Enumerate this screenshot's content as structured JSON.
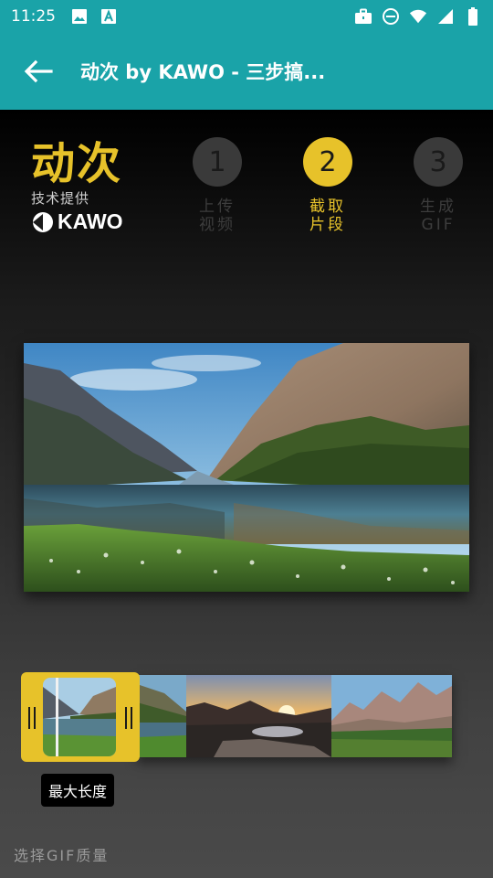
{
  "status_bar": {
    "time": "11:25",
    "icons_left": [
      "image-icon",
      "font-app-icon"
    ],
    "icons_right": [
      "briefcase-icon",
      "do-not-disturb-icon",
      "wifi-icon",
      "signal-icon",
      "battery-icon"
    ],
    "background": "#1aa3a8"
  },
  "app_bar": {
    "title": "动次 by KAWO - 三步搞...",
    "back_icon": "arrow-left-icon",
    "background": "#1aa3a8"
  },
  "brand": {
    "title": "动次",
    "subtitle": "技术提供",
    "logo_text": "KAWO",
    "accent_color": "#e7c22a"
  },
  "steps": [
    {
      "number": "1",
      "line1": "上传",
      "line2": "视频",
      "state": "inactive"
    },
    {
      "number": "2",
      "line1": "截取",
      "line2": "片段",
      "state": "active"
    },
    {
      "number": "3",
      "line1": "生成",
      "line2": "GIF",
      "state": "inactive"
    }
  ],
  "preview": {
    "subject": "mountain lake landscape"
  },
  "filmstrip": {
    "frames": [
      "fjord-reflection",
      "sunset-mountains",
      "rocky-mountains-meadow"
    ]
  },
  "selector": {
    "tooltip": "最大长度"
  },
  "quality": {
    "label": "选择GIF质量"
  }
}
